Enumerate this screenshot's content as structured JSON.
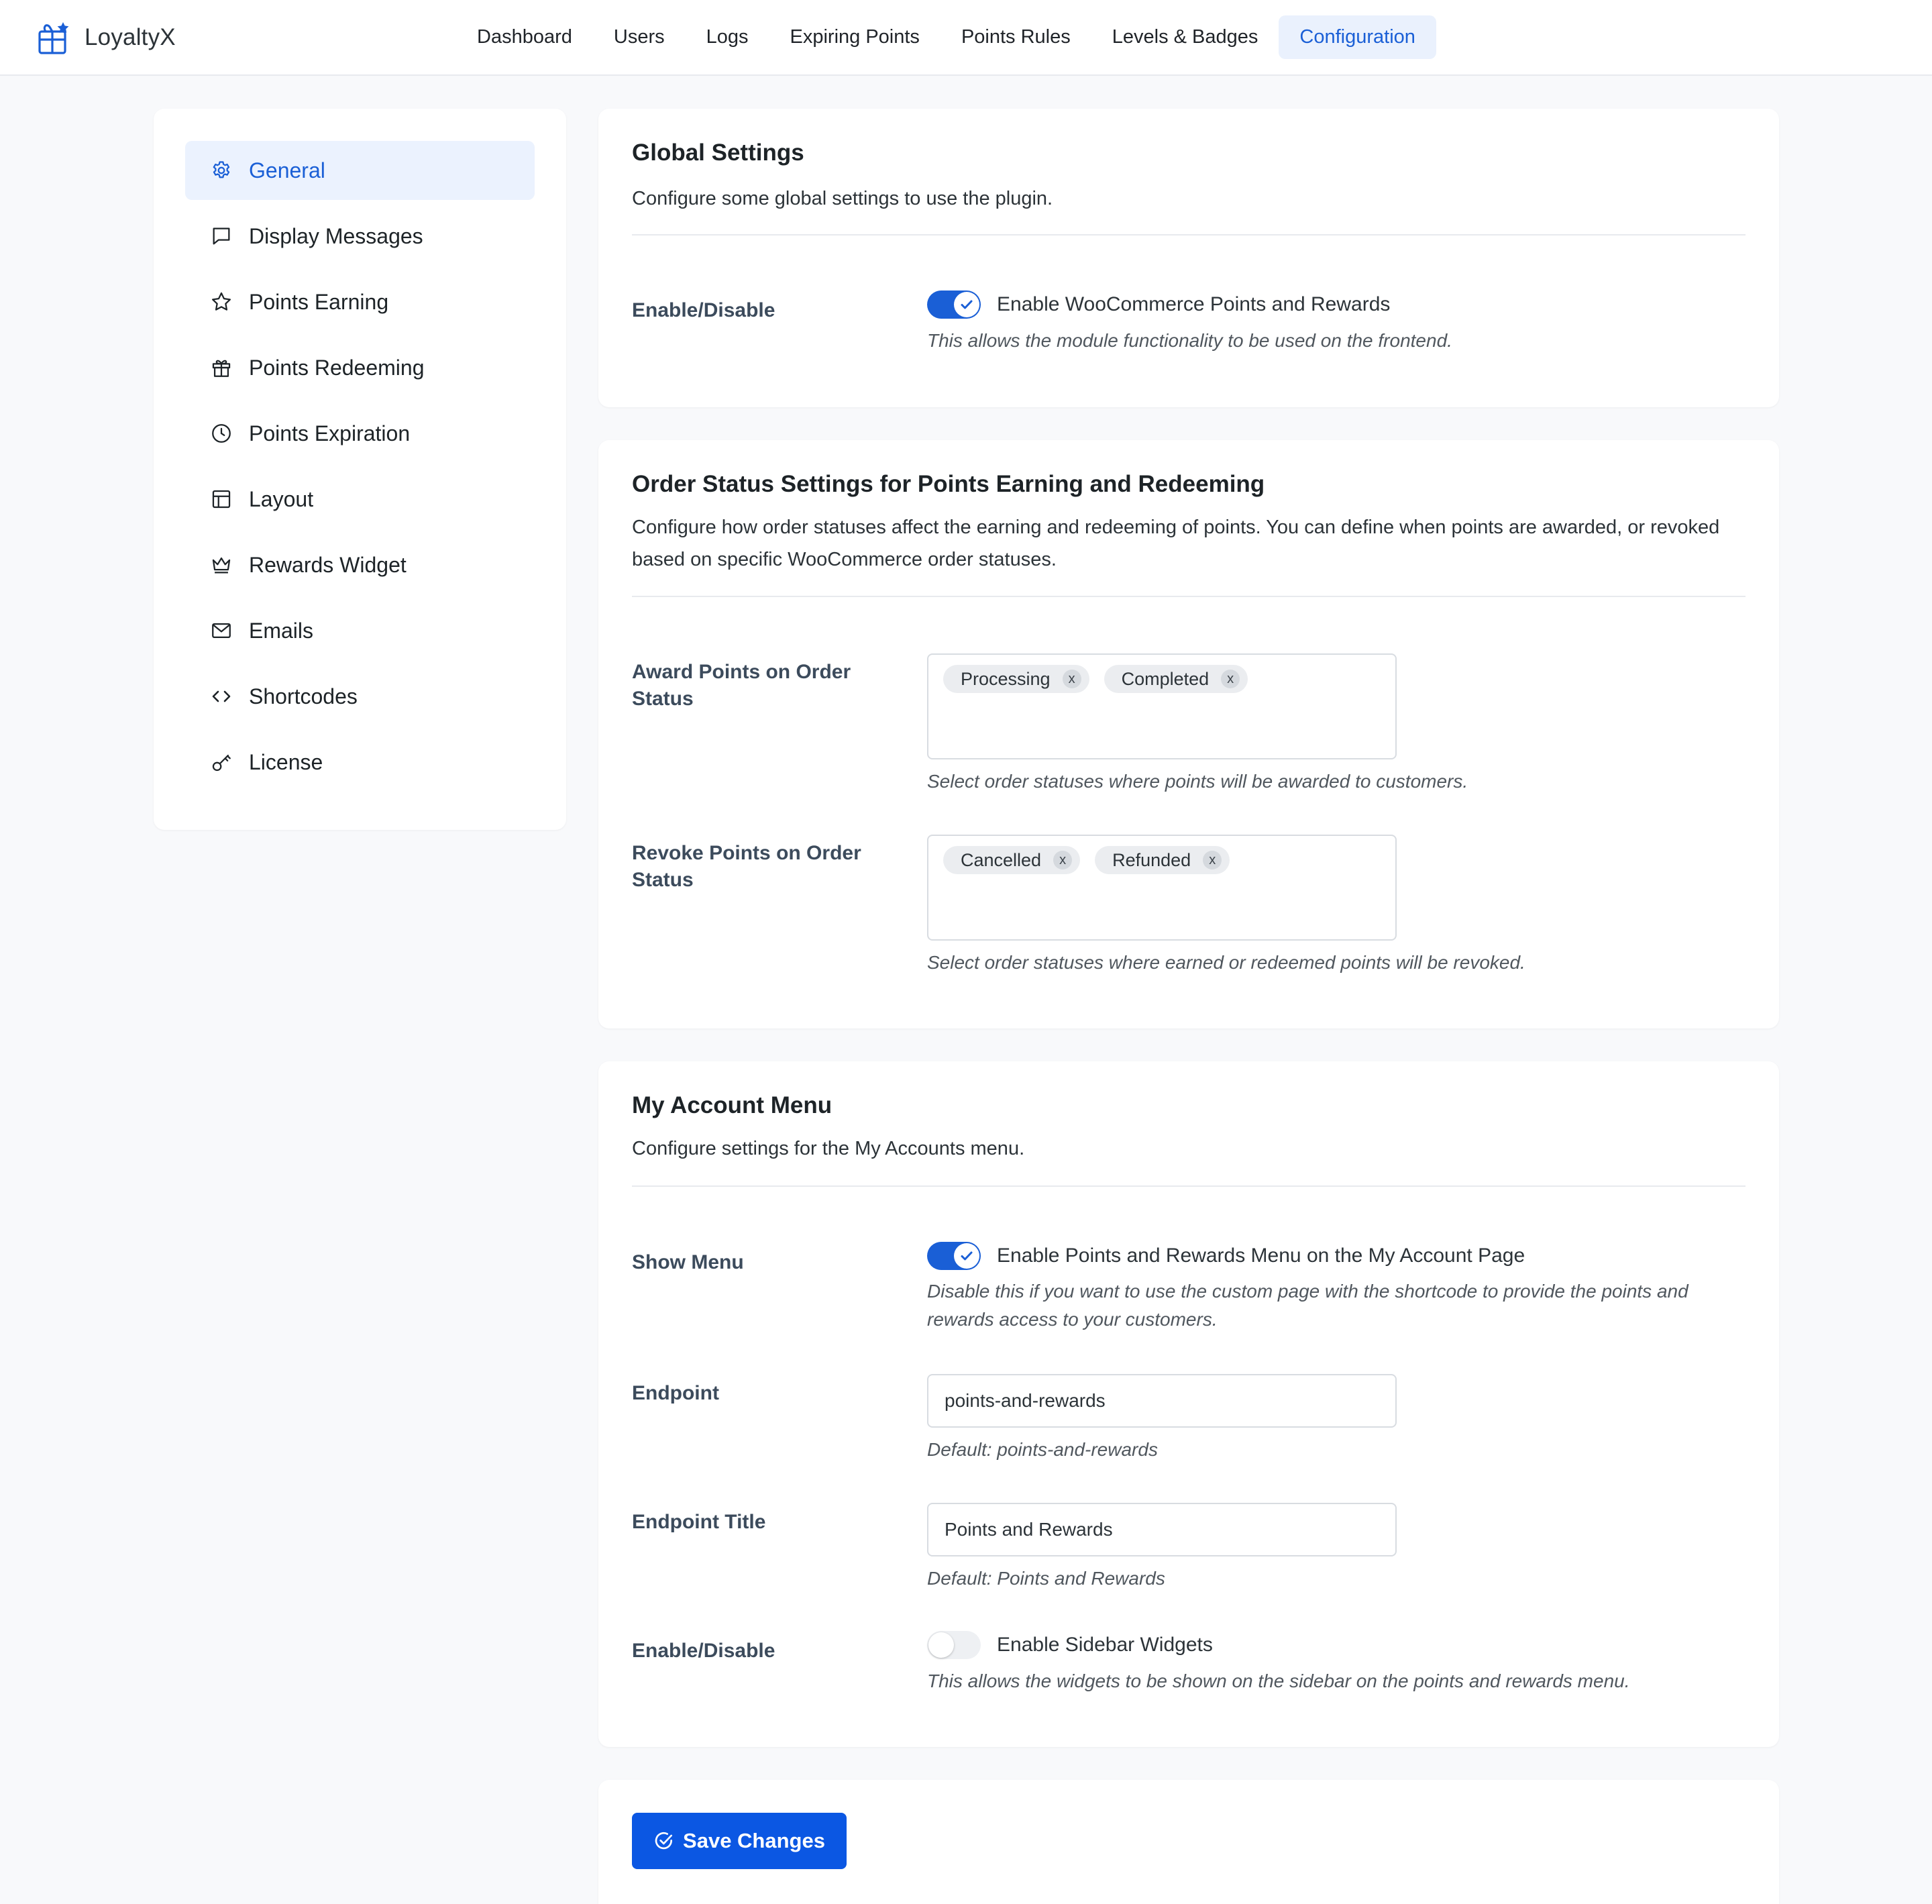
{
  "app": {
    "name": "LoyaltyX"
  },
  "colors": {
    "accent": "#1a5fd6",
    "button": "#0b57e3",
    "page_bg": "#f8f9fb"
  },
  "top_nav": {
    "items": [
      {
        "label": "Dashboard",
        "active": false
      },
      {
        "label": "Users",
        "active": false
      },
      {
        "label": "Logs",
        "active": false
      },
      {
        "label": "Expiring Points",
        "active": false
      },
      {
        "label": "Points Rules",
        "active": false
      },
      {
        "label": "Levels & Badges",
        "active": false
      },
      {
        "label": "Configuration",
        "active": true
      }
    ]
  },
  "sidebar": {
    "items": [
      {
        "label": "General",
        "icon": "gear-icon",
        "active": true
      },
      {
        "label": "Display Messages",
        "icon": "message-icon",
        "active": false
      },
      {
        "label": "Points Earning",
        "icon": "star-icon",
        "active": false
      },
      {
        "label": "Points Redeeming",
        "icon": "gift-icon",
        "active": false
      },
      {
        "label": "Points Expiration",
        "icon": "clock-icon",
        "active": false
      },
      {
        "label": "Layout",
        "icon": "layout-icon",
        "active": false
      },
      {
        "label": "Rewards Widget",
        "icon": "crown-icon",
        "active": false
      },
      {
        "label": "Emails",
        "icon": "mail-icon",
        "active": false
      },
      {
        "label": "Shortcodes",
        "icon": "code-icon",
        "active": false
      },
      {
        "label": "License",
        "icon": "key-icon",
        "active": false
      }
    ]
  },
  "global_settings": {
    "title": "Global Settings",
    "description": "Configure some global settings to use the plugin.",
    "enable": {
      "label": "Enable/Disable",
      "toggle_text": "Enable WooCommerce Points and Rewards",
      "checked": true,
      "hint": "This allows the module functionality to be used on the frontend."
    }
  },
  "order_status": {
    "title": "Order Status Settings for Points Earning and Redeeming",
    "description": "Configure how order statuses affect the earning and redeeming of points. You can define when points are awarded, or revoked based on specific WooCommerce order statuses.",
    "award": {
      "label": "Award Points on Order Status",
      "tags": [
        "Processing",
        "Completed"
      ],
      "hint": "Select order statuses where points will be awarded to customers."
    },
    "revoke": {
      "label": "Revoke Points on Order Status",
      "tags": [
        "Cancelled",
        "Refunded"
      ],
      "hint": "Select order statuses where earned or redeemed points will be revoked."
    },
    "tag_remove_glyph": "x"
  },
  "my_account": {
    "title": "My Account Menu",
    "description": "Configure settings for the My Accounts menu.",
    "show_menu": {
      "label": "Show Menu",
      "toggle_text": "Enable Points and Rewards Menu on the My Account Page",
      "checked": true,
      "hint": "Disable this if you want to use the custom page with the shortcode to provide the points and rewards access to your customers."
    },
    "endpoint": {
      "label": "Endpoint",
      "value": "points-and-rewards",
      "hint": "Default: points-and-rewards"
    },
    "endpoint_title": {
      "label": "Endpoint Title",
      "value": "Points and Rewards",
      "hint": "Default: Points and Rewards"
    },
    "sidebar_widgets": {
      "label": "Enable/Disable",
      "toggle_text": "Enable Sidebar Widgets",
      "checked": false,
      "hint": "This allows the widgets to be shown on the sidebar on the points and rewards menu."
    }
  },
  "actions": {
    "save_label": "Save Changes"
  }
}
